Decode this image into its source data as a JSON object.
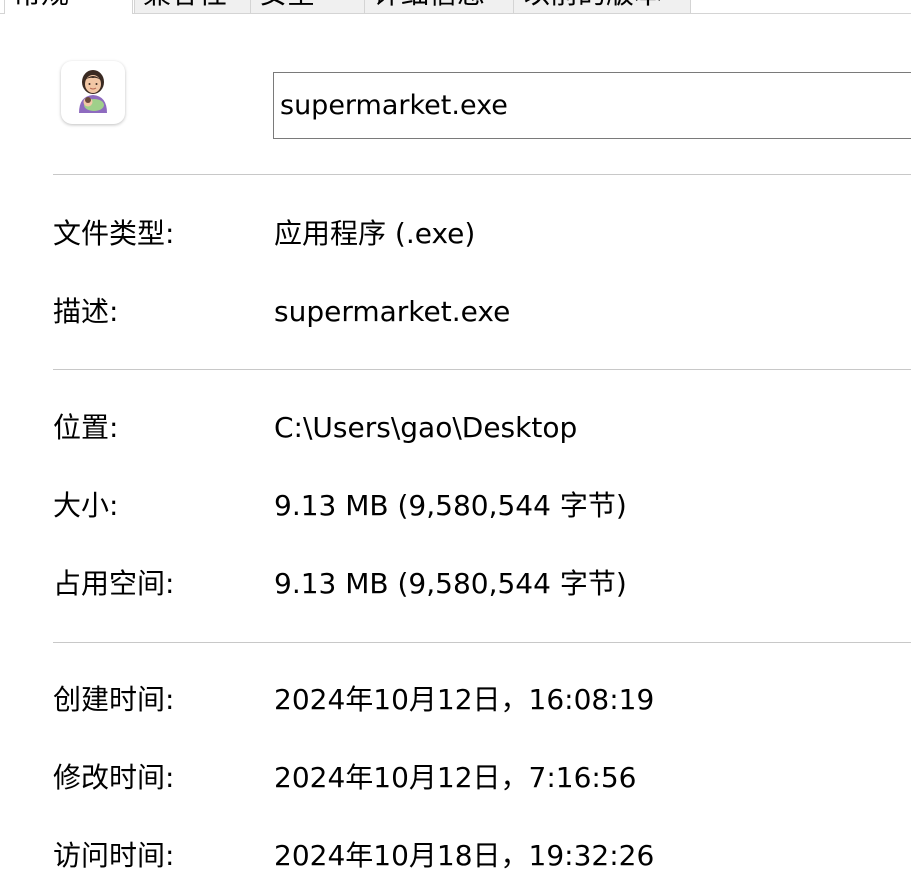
{
  "tabs": [
    {
      "label": "常规",
      "active": true
    },
    {
      "label": "兼容性",
      "active": false
    },
    {
      "label": "安全",
      "active": false
    },
    {
      "label": "详细信息",
      "active": false
    },
    {
      "label": "以前的版本",
      "active": false
    }
  ],
  "header": {
    "icon": "person-app-icon",
    "file_name": "supermarket.exe"
  },
  "properties": {
    "type": {
      "label": "文件类型:",
      "value": "应用程序 (.exe)"
    },
    "description": {
      "label": "描述:",
      "value": "supermarket.exe"
    },
    "location": {
      "label": "位置:",
      "value": "C:\\Users\\gao\\Desktop"
    },
    "size": {
      "label": "大小:",
      "value": "9.13 MB (9,580,544 字节)"
    },
    "size_on_disk": {
      "label": "占用空间:",
      "value": "9.13 MB (9,580,544 字节)"
    },
    "created": {
      "label": "创建时间:",
      "value": "2024年10月12日，16:08:19"
    },
    "modified": {
      "label": "修改时间:",
      "value": "2024年10月12日，7:16:56"
    },
    "accessed": {
      "label": "访问时间:",
      "value": "2024年10月18日，19:32:26"
    }
  },
  "colors": {
    "background": "#ffffff",
    "separator": "#c8c8c8",
    "field_border": "#7a7a7a"
  }
}
